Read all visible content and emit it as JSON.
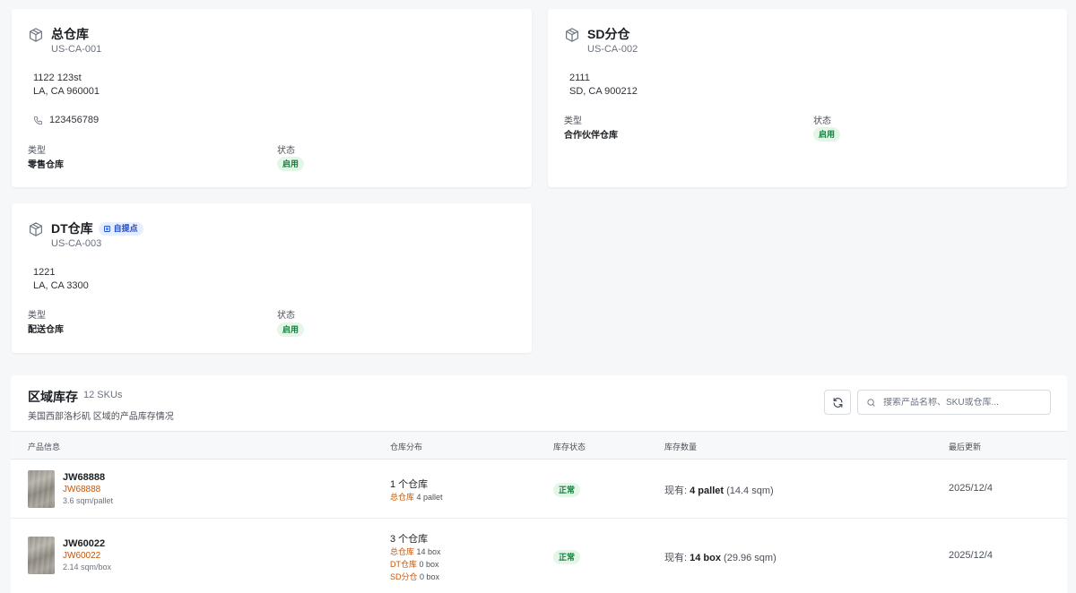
{
  "warehouses": [
    {
      "name": "总仓库",
      "code": "US-CA-001",
      "address_line1": "1122 123st",
      "address_line2": "LA, CA 960001",
      "phone": "123456789",
      "type_label": "类型",
      "type_value": "零售仓库",
      "status_label": "状态",
      "status_value": "启用"
    },
    {
      "name": "SD分仓",
      "code": "US-CA-002",
      "address_line1": "2111",
      "address_line2": "SD, CA 900212",
      "type_label": "类型",
      "type_value": "合作伙伴仓库",
      "status_label": "状态",
      "status_value": "启用"
    },
    {
      "name": "DT仓库",
      "badge": "自提点",
      "code": "US-CA-003",
      "address_line1": "1221",
      "address_line2": "LA, CA 3300",
      "type_label": "类型",
      "type_value": "配送仓库",
      "status_label": "状态",
      "status_value": "启用"
    }
  ],
  "inventory": {
    "title": "区域库存",
    "sku_count": "12 SKUs",
    "subtitle": "美国西部洛杉矶 区域的产品库存情况",
    "search_placeholder": "搜索产品名称、SKU或仓库...",
    "columns": [
      "产品信息",
      "仓库分布",
      "库存状态",
      "库存数量",
      "最后更新"
    ],
    "rows": [
      {
        "name": "JW68888",
        "sku": "JW68888",
        "unit": "3.6 sqm/pallet",
        "warehouse_count": "1 个仓库",
        "distribution": [
          {
            "warehouse": "总仓库",
            "qty": "4 pallet"
          }
        ],
        "status": "正常",
        "qty_prefix": "现有:",
        "qty_value": "4 pallet",
        "qty_area": "(14.4 sqm)",
        "updated": "2025/12/4"
      },
      {
        "name": "JW60022",
        "sku": "JW60022",
        "unit": "2.14 sqm/box",
        "warehouse_count": "3 个仓库",
        "distribution": [
          {
            "warehouse": "总仓库",
            "qty": "14 box"
          },
          {
            "warehouse": "DT仓库",
            "qty": "0 box"
          },
          {
            "warehouse": "SD分仓",
            "qty": "0 box"
          }
        ],
        "status": "正常",
        "qty_prefix": "现有:",
        "qty_value": "14 box",
        "qty_area": "(29.96 sqm)",
        "updated": "2025/12/4"
      }
    ]
  }
}
